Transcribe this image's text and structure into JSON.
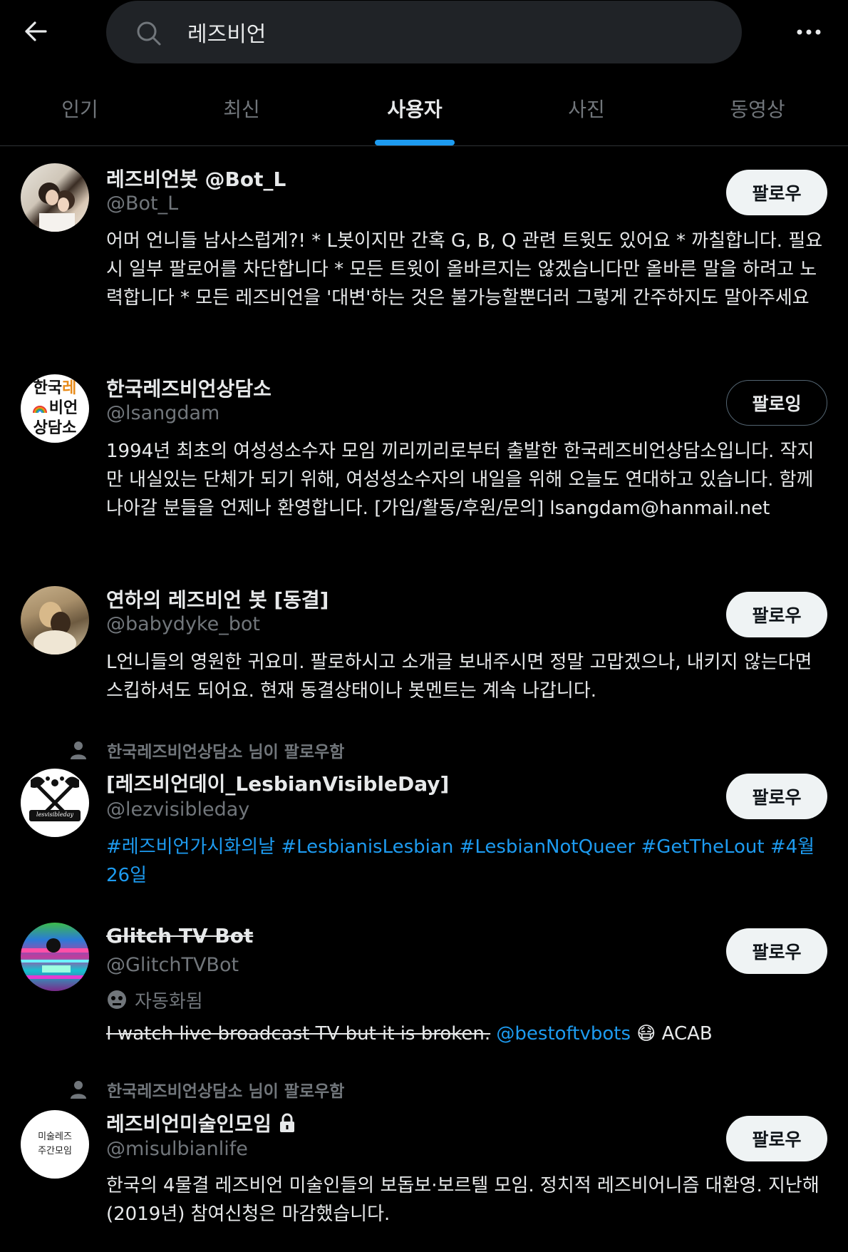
{
  "search": {
    "query": "레즈비언"
  },
  "tabs": [
    {
      "label": "인기"
    },
    {
      "label": "최신"
    },
    {
      "label": "사용자"
    },
    {
      "label": "사진"
    },
    {
      "label": "동영상"
    }
  ],
  "active_tab": "사용자",
  "users": [
    {
      "name": "레즈비언봇 @Bot_L",
      "handle": "@Bot_L",
      "bio": "어머 언니들 남사스럽게?! * L봇이지만 간혹 G, B, Q 관련 트윗도 있어요 * 까칠합니다. 필요시 일부 팔로어를 차단합니다 * 모든 트윗이 올바르지는 않겠습니다만 올바른 말을 하려고 노력합니다 * 모든 레즈비언을 '대변'하는 것은 불가능할뿐더러 그렇게 간주하지도 말아주세요",
      "button": "팔로우"
    },
    {
      "name": "한국레즈비언상담소",
      "handle": "@lsangdam",
      "bio": "1994년 최초의 여성성소수자 모임 끼리끼리로부터 출발한 한국레즈비언상담소입니다. 작지만 내실있는 단체가 되기 위해, 여성성소수자의 내일을 위해 오늘도 연대하고 있습니다. 함께 나아갈 분들을 언제나 환영합니다. [가입/활동/후원/문의] lsangdam@hanmail.net",
      "button": "팔로잉",
      "avatar_text": [
        "한국",
        "레",
        "비언",
        "상담소"
      ]
    },
    {
      "name": "연하의 레즈비언 봇 [동결]",
      "handle": "@babydyke_bot",
      "bio": "L언니들의 영원한 귀요미. 팔로하시고 소개글 보내주시면 정말 고맙겠으나, 내키지 않는다면 스킵하셔도 되어요. 현재 동결상태이나 봇멘트는 계속 나갑니다.",
      "button": "팔로우"
    },
    {
      "social_context": "한국레즈비언상담소 님이 팔로우함",
      "name": "[레즈비언데이_LesbianVisibleDay]",
      "handle": "@lezvisibleday",
      "bio": "#레즈비언가시화의날 #LesbianisLesbian #LesbianNotQueer #GetTheLout #4월26일",
      "button": "팔로우",
      "avatar_text": "lesvisibleday"
    },
    {
      "name": "Glitch TV Bot",
      "handle": "@GlitchTVBot",
      "automated_label": "자동화됨",
      "bio_plain": "I watch live broadcast TV but it is broken.",
      "bio_link": "@bestoftvbots",
      "bio_emoji": "😷",
      "bio_end": "ACAB",
      "button": "팔로우"
    },
    {
      "social_context": "한국레즈비언상담소 님이 팔로우함",
      "name": "레즈비언미술인모임",
      "handle": "@misulbianlife",
      "bio": "한국의 4물결 레즈비언 미술인들의 보돕보·보르텔 모임. 정치적 레즈비어니즘 대환영. 지난해(2019년) 참여신청은 마감했습니다.",
      "button": "팔로우",
      "avatar_text": [
        "미술레즈",
        "주간모임"
      ]
    }
  ],
  "colors": {
    "background": "#000000",
    "accent": "#1d9bf0",
    "muted": "#71767b",
    "button_bg": "#eff3f4"
  }
}
